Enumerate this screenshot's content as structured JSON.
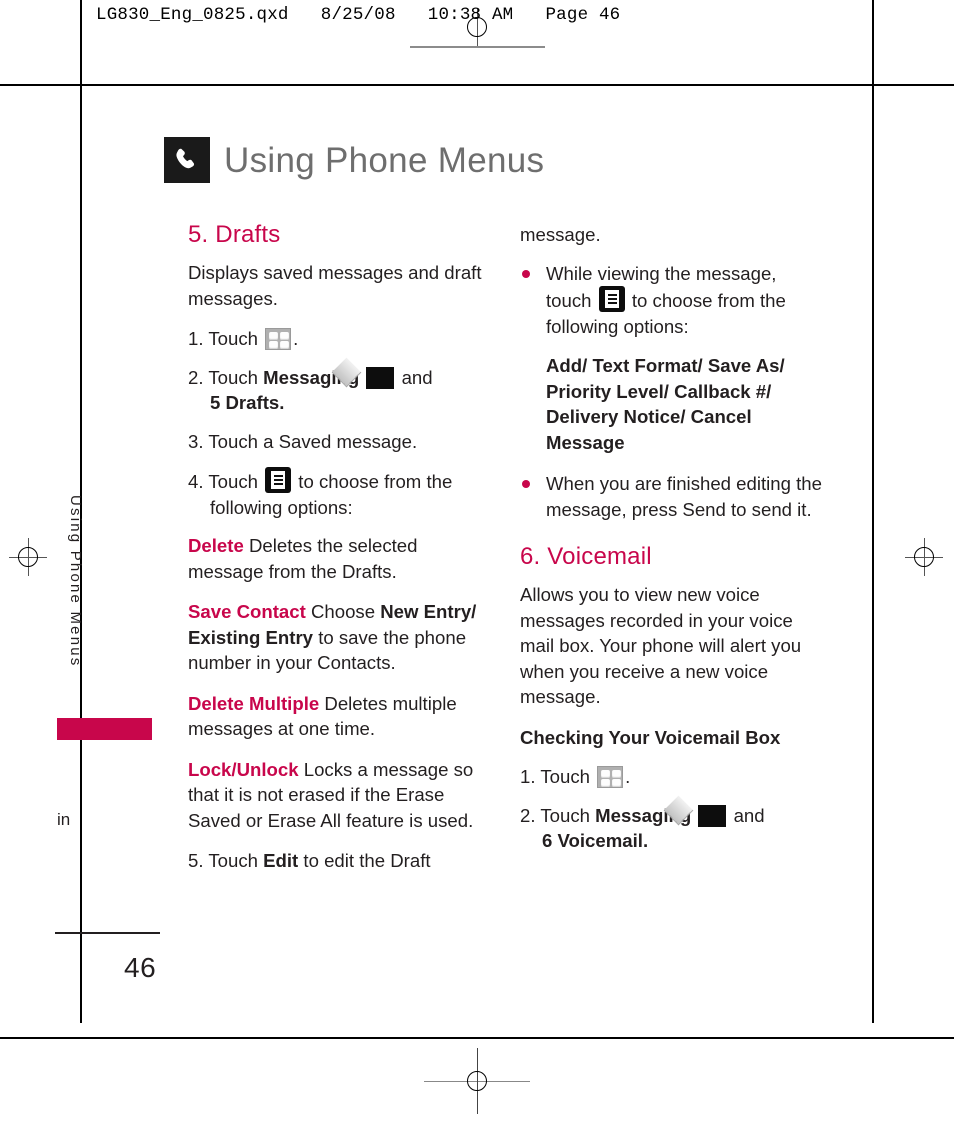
{
  "slug": {
    "text": "LG830_Eng_0825.qxd   8/25/08   10:38 AM   Page 46"
  },
  "chapter": {
    "icon": "phone-handset-icon",
    "title": "Using Phone Menus"
  },
  "side": {
    "vertical_label": "Using Phone Menus",
    "margin_word": "in",
    "page_number": "46",
    "tab_color": "#c8064b"
  },
  "colors": {
    "accent": "#c8064b",
    "title_gray": "#6e6e6e",
    "body": "#231f20"
  },
  "left_column": {
    "section_title": "5. Drafts",
    "intro": "Displays saved messages and draft messages.",
    "step1_pre": "1. Touch",
    "step1_post": ".",
    "step2_pre": "2. Touch",
    "step2_bold": "Messaging",
    "step2_mid": "and",
    "step2_cont": "5 Drafts.",
    "step3": "3. Touch a Saved message.",
    "step4_pre": "4. Touch",
    "step4_post": "to choose from the",
    "step4_cont": "following options:",
    "options": [
      {
        "term": "Delete",
        "desc": "Deletes the selected message from the Drafts."
      },
      {
        "term": "Save Contact",
        "desc_pre": "Choose",
        "desc_bold": "New Entry/ Existing Entry",
        "desc_post": "to save the phone number in your Contacts."
      },
      {
        "term": "Delete Multiple",
        "desc": "Deletes multiple messages at one time."
      },
      {
        "term": "Lock/Unlock",
        "desc": "Locks a message so that it is not erased if the Erase Saved or Erase All feature is used."
      }
    ],
    "step5_pre": "5. Touch",
    "step5_bold": "Edit",
    "step5_post": "to edit the Draft"
  },
  "right_column": {
    "continuation": "message.",
    "bullet1_pre": "While viewing the message, touch",
    "bullet1_post": "to choose from the following options:",
    "option_list": "Add/ Text Format/ Save As/ Priority Level/ Callback #/ Delivery Notice/ Cancel Message",
    "bullet2": "When you are finished editing the message, press Send to send it.",
    "section_title": "6. Voicemail",
    "intro": "Allows you to view new voice messages recorded in your voice mail box. Your phone will alert you when you receive a new voice message.",
    "subhead": "Checking Your Voicemail Box",
    "step1_pre": "1. Touch",
    "step1_post": ".",
    "step2_pre": "2. Touch",
    "step2_bold": "Messaging",
    "step2_mid": "and",
    "step2_cont": "6 Voicemail."
  }
}
